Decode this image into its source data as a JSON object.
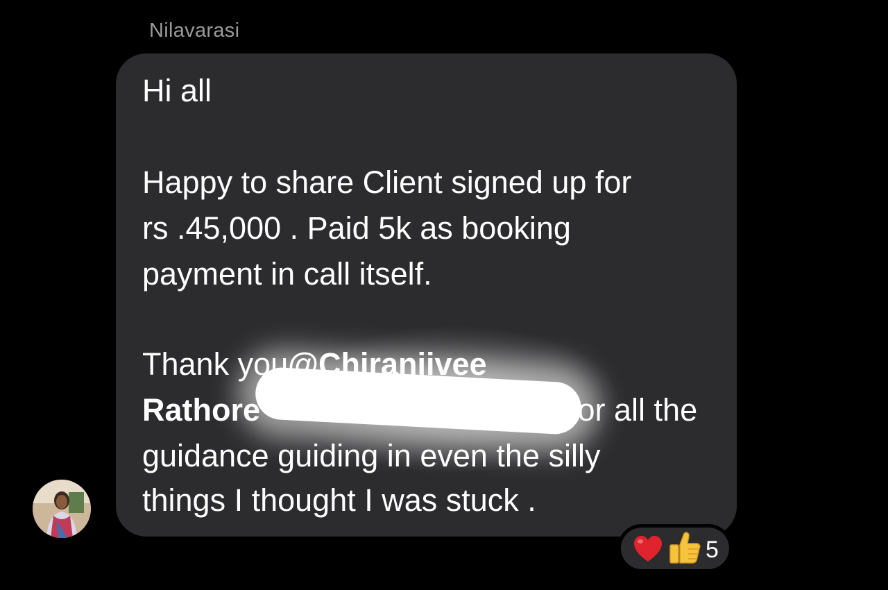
{
  "message": {
    "sender_name": "Nilavarasi",
    "lines": [
      "Hi all",
      "Happy to share Client signed up for",
      "rs .45,000 . Paid 5k as booking",
      "payment in call itself.",
      "Thank you",
      "@Chiranjivee",
      "Rathore",
      "for all the",
      "guidance guiding in even the silly",
      "things I thought I was stuck ."
    ]
  },
  "reactions": {
    "icons": [
      "heart-emoji",
      "thumbs-up-emoji"
    ],
    "count": "5"
  },
  "colors": {
    "background": "#000000",
    "bubble": "#2c2c2e",
    "sender_name": "#9a9a9a",
    "text": "#ffffff"
  }
}
